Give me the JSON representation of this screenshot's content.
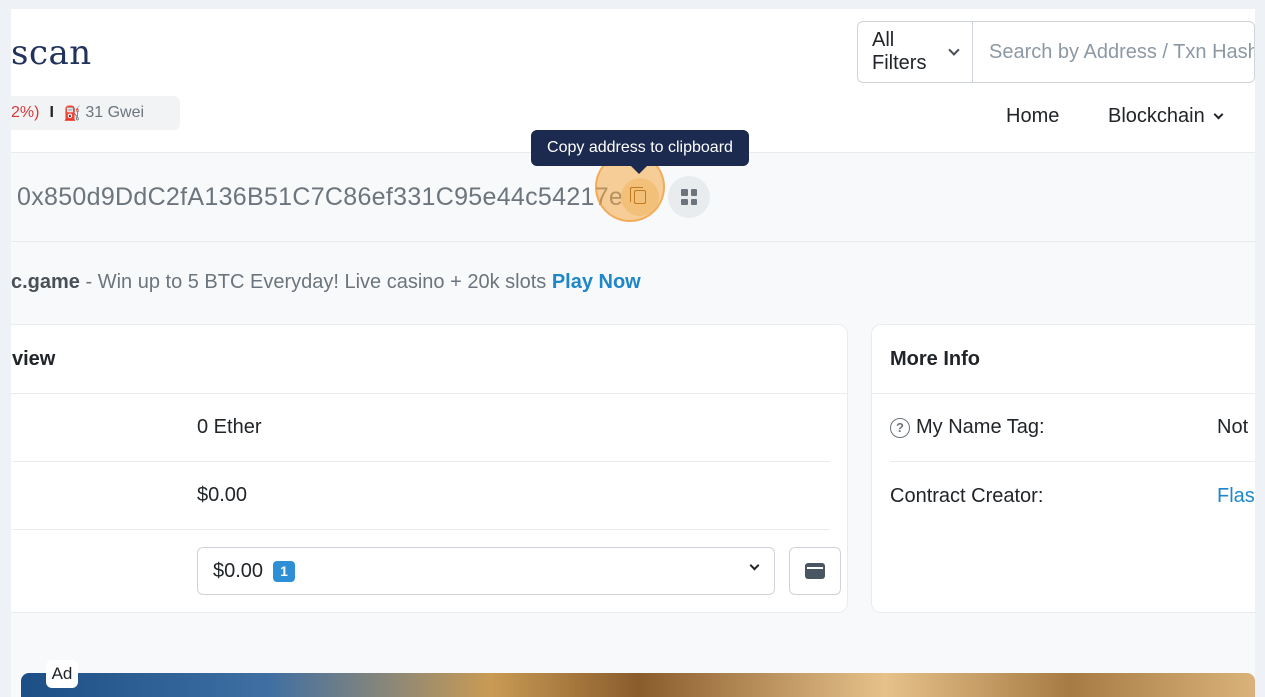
{
  "header": {
    "logo_text": "scan",
    "stats": {
      "price_change": "2%)",
      "separator": "I",
      "gas": "31 Gwei"
    },
    "search": {
      "filter_label": "All Filters",
      "placeholder": "Search by Address / Txn Hash / Block / Token / Domain Name"
    },
    "nav": {
      "home": "Home",
      "blockchain": "Blockchain"
    }
  },
  "address": {
    "value": "0x850d9DdC2fA136B51C7C86ef331C95e44c54217e",
    "copy_tooltip": "Copy address to clipboard"
  },
  "promo": {
    "brand": "c.game",
    "text": " - Win up to 5 BTC Everyday! Live casino + 20k slots ",
    "cta": "Play Now"
  },
  "overview": {
    "title": "view",
    "rows": [
      {
        "value": "0 Ether"
      },
      {
        "value": "$0.00"
      }
    ],
    "holdings": {
      "value": "$0.00",
      "badge": "1"
    }
  },
  "more_info": {
    "title": "More Info",
    "name_tag": {
      "label": "My Name Tag:",
      "value": "Not"
    },
    "creator": {
      "label": "Contract Creator:",
      "value": "Flas"
    }
  },
  "ad": {
    "label": "Ad"
  },
  "colors": {
    "accent_link": "#1e87c9",
    "tooltip_bg": "#1b2a4e",
    "badge": "#2f8fd6",
    "highlight": "#f2c078"
  }
}
